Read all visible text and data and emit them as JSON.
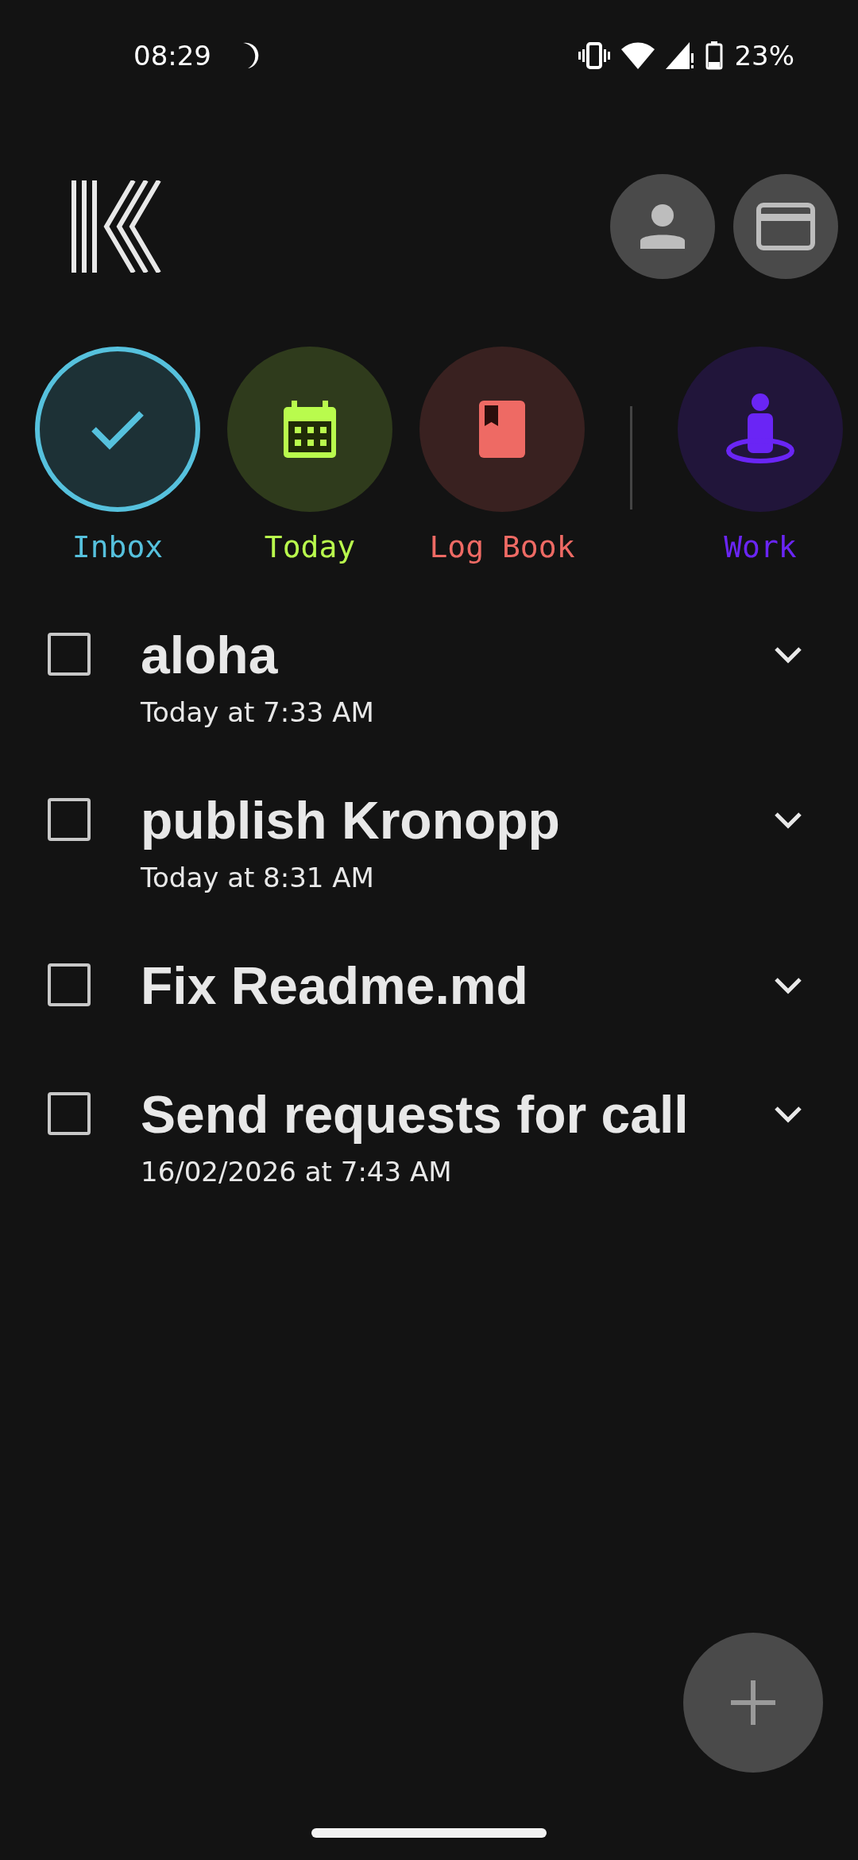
{
  "status_bar": {
    "time": "08:29",
    "battery": "23%"
  },
  "categories": [
    {
      "label": "Inbox",
      "kind": "check",
      "color": "#56c1dd",
      "selected": true
    },
    {
      "label": "Today",
      "kind": "calendar",
      "color": "#b9fb4d",
      "selected": false
    },
    {
      "label": "Log Book",
      "kind": "book",
      "color": "#ee6a64",
      "selected": false
    },
    {
      "label": "Work",
      "kind": "person",
      "color": "#6a25f5",
      "selected": false
    }
  ],
  "tasks": [
    {
      "title": "aloha",
      "time": "Today at 7:33 AM",
      "checked": false
    },
    {
      "title": "publish Kronopp",
      "time": "Today at 8:31 AM",
      "checked": false
    },
    {
      "title": "Fix Readme.md",
      "checked": false
    },
    {
      "title": "Send requests for call",
      "time": "16/02/2026 at 7:43 AM",
      "checked": false
    }
  ]
}
